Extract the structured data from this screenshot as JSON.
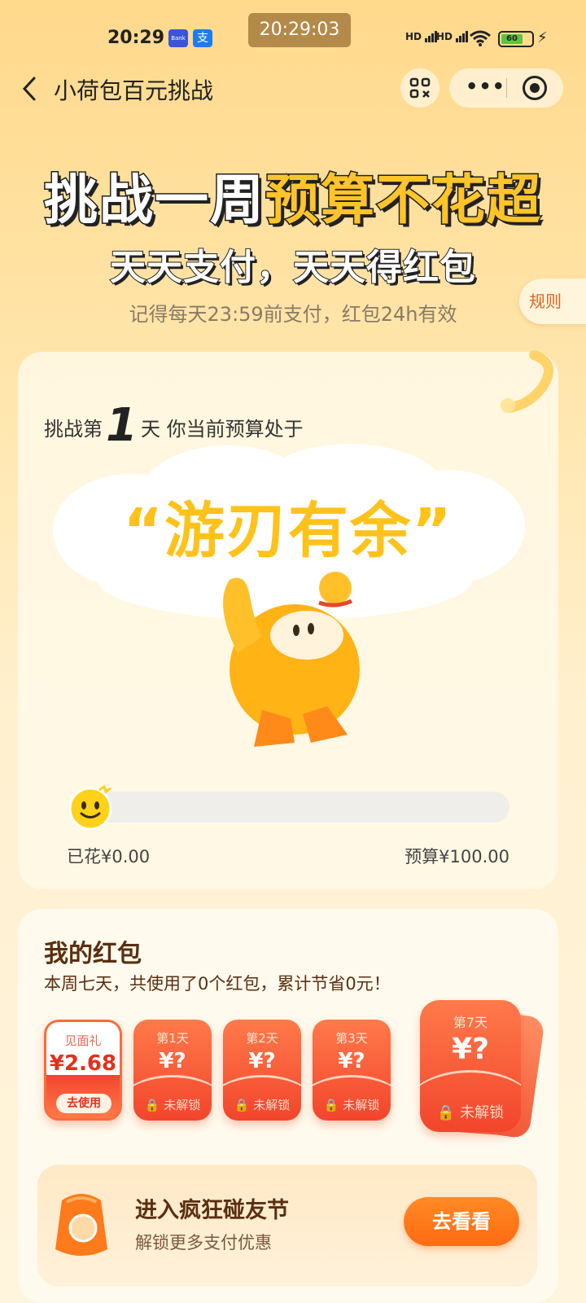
{
  "status_bar": {
    "time": "20:29",
    "clock_overlay": "20:29:03",
    "app1": "Bank",
    "app2": "支",
    "signal1": "HD",
    "signal2": "HD",
    "battery": "60"
  },
  "nav": {
    "title": "小荷包百元挑战"
  },
  "hero": {
    "headline_a": "挑战一周",
    "headline_b": "预算不花超",
    "subhead": "天天支付，天天得红包",
    "notice": "记得每天23:59前支付，红包24h有效",
    "rules": "规则"
  },
  "challenge": {
    "prefix": "挑战第",
    "day": "1",
    "suffix": "天 你当前预算处于",
    "status": "“游刃有余”",
    "progress_fraction": 0,
    "spent": "已花¥0.00",
    "budget": "预算¥100.00"
  },
  "packets": {
    "title": "我的红包",
    "subtitle": "本周七天，共使用了0个红包，累计节省0元！",
    "gift": {
      "label": "见面礼",
      "amount": "¥2.68",
      "action": "去使用"
    },
    "days": [
      {
        "label": "第1天",
        "amount": "¥?",
        "state": "未解锁"
      },
      {
        "label": "第2天",
        "amount": "¥?",
        "state": "未解锁"
      },
      {
        "label": "第3天",
        "amount": "¥?",
        "state": "未解锁"
      }
    ],
    "final": {
      "label": "第7天",
      "amount": "¥?",
      "state": "未解锁"
    }
  },
  "banner": {
    "title": "进入疯狂碰友节",
    "subtitle": "解锁更多支付优惠",
    "button": "去看看"
  },
  "colors": {
    "accent_orange": "#ff6a12",
    "packet_red": "#f2452c",
    "status_yellow": "#ffc21a",
    "text_brown": "#5a2f10"
  }
}
